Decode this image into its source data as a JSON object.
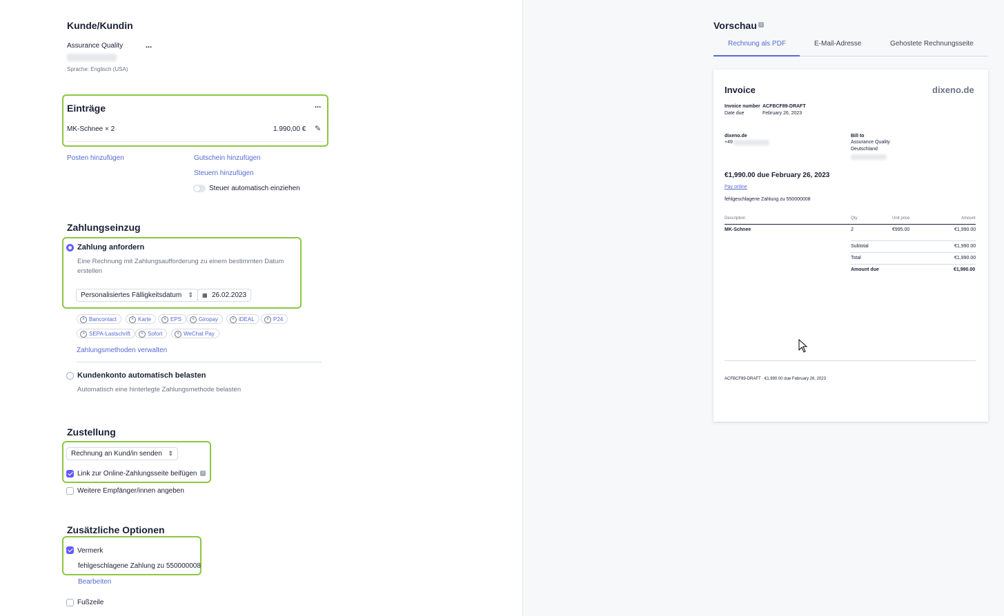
{
  "customer": {
    "heading": "Kunde/Kundin",
    "name": "Assurance Quality",
    "language": "Sprache: Englisch (USA)",
    "more": "..."
  },
  "items": {
    "heading": "Einträge",
    "more": "...",
    "line_name": "MK-Schnee × 2",
    "line_amount": "1.990,00 €",
    "add_item": "Posten hinzufügen",
    "add_coupon": "Gutschein hinzufügen",
    "add_tax": "Steuern hinzufügen",
    "auto_tax": "Steuer automatisch einziehen"
  },
  "payment": {
    "heading": "Zahlungseinzug",
    "request_label": "Zahlung anfordern",
    "request_desc_1": "Eine Rechnung mit Zahlungsaufforderung zu einem bestimmten Datum",
    "request_desc_2": "erstellen",
    "due_select": "Personalisiertes Fälligkeitsdatum",
    "due_date": "26.02.2023",
    "methods": [
      "Bancontact",
      "Karte",
      "EPS",
      "Giropay",
      "iDEAL",
      "P24",
      "SEPA-Lastschrift",
      "Sofort",
      "WeChat Pay"
    ],
    "manage_methods": "Zahlungsmethoden verwalten",
    "auto_charge_label": "Kundenkonto automatisch belasten",
    "auto_charge_desc": "Automatisch eine hinterlegte Zahlungsmethode belasten"
  },
  "delivery": {
    "heading": "Zustellung",
    "send_select": "Rechnung an Kund/in senden",
    "include_link": "Link zur Online-Zahlungsseite beifügen",
    "more_recipients": "Weitere Empfänger/innen angeben"
  },
  "options": {
    "heading": "Zusätzliche Optionen",
    "memo_label": "Vermerk",
    "memo_text": "fehlgeschlagene Zahlung zu 550000008",
    "edit": "Bearbeiten",
    "footer_label": "Fußzeile"
  },
  "preview": {
    "heading": "Vorschau",
    "tabs": [
      "Rechnung als PDF",
      "E-Mail-Adresse",
      "Gehostete Rechnungsseite"
    ],
    "active_tab": 0
  },
  "invoice": {
    "title": "Invoice",
    "brand": "dixeno.de",
    "number_label": "Invoice number",
    "number": "ACFBCF89-DRAFT",
    "date_label": "Date due",
    "date": "February 26, 2023",
    "from_name": "dixeno.de",
    "from_phone": "+49",
    "bill_to_label": "Bill to",
    "bill_to_name": "Assurance Quality",
    "bill_to_country": "Deutschland",
    "amount_due_headline": "€1,990.00 due February 26, 2023",
    "pay_online": "Pay online",
    "memo": "fehlgeschlagene Zahlung zu  550000008",
    "col_description": "Description",
    "col_qty": "Qty",
    "col_unit": "Unit price",
    "col_amount": "Amount",
    "row_desc": "MK-Schnee",
    "row_qty": "2",
    "row_unit": "€995.00",
    "row_amount": "€1,990.00",
    "subtotal_label": "Subtotal",
    "subtotal": "€1,990.00",
    "total_label": "Total",
    "total": "€1,990.00",
    "amount_due_label": "Amount due",
    "amount_due": "€1,990.00",
    "footer": "ACFBCF89-DRAFT · €1,990.00 due February 26, 2023"
  },
  "colors": {
    "accent": "#635bff",
    "link": "#5469d4",
    "highlight": "#8cc63f"
  }
}
